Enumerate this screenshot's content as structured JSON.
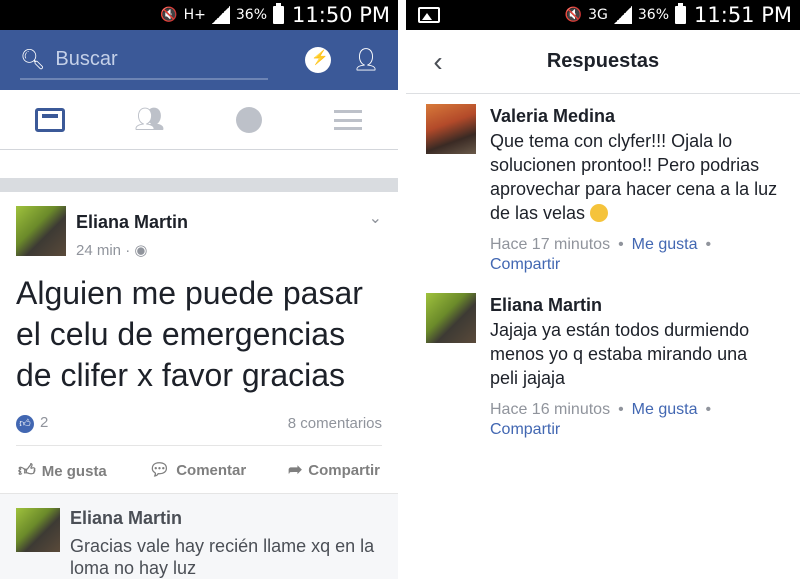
{
  "status_left": {
    "hplus": "H+",
    "battery": "36%",
    "time": "11:50 PM"
  },
  "status_right": {
    "net": "3G",
    "battery": "36%",
    "time": "11:51 PM"
  },
  "search": {
    "placeholder": "Buscar"
  },
  "post": {
    "author": "Eliana Martin",
    "time": "24 min",
    "text": "Alguien me puede pasar el celu de emergencias de clifer x favor gracias",
    "likes": "2",
    "comments": "8 comentarios",
    "actions": {
      "like": "Me gusta",
      "comment": "Comentar",
      "share": "Compartir"
    }
  },
  "last_comment": {
    "author": "Eliana Martin",
    "text": "Gracias vale hay recién llame xq en la loma no hay luz"
  },
  "replies_view": {
    "title": "Respuestas",
    "replies": [
      {
        "author": "Valeria Medina",
        "text": "Que tema con clyfer!!! Ojala lo solucionen prontoo!! Pero podrias aprovechar para hacer cena a la luz de las velas",
        "time": "Hace 17 minutos",
        "like": "Me gusta",
        "share": "Compartir"
      },
      {
        "author": "Eliana Martin",
        "text": "Jajaja ya están todos durmiendo menos yo q estaba mirando una peli jajaja",
        "time": "Hace 16 minutos",
        "like": "Me gusta",
        "share": "Compartir"
      }
    ]
  },
  "colors": {
    "fb_blue": "#3b5998",
    "link": "#4267b2"
  }
}
